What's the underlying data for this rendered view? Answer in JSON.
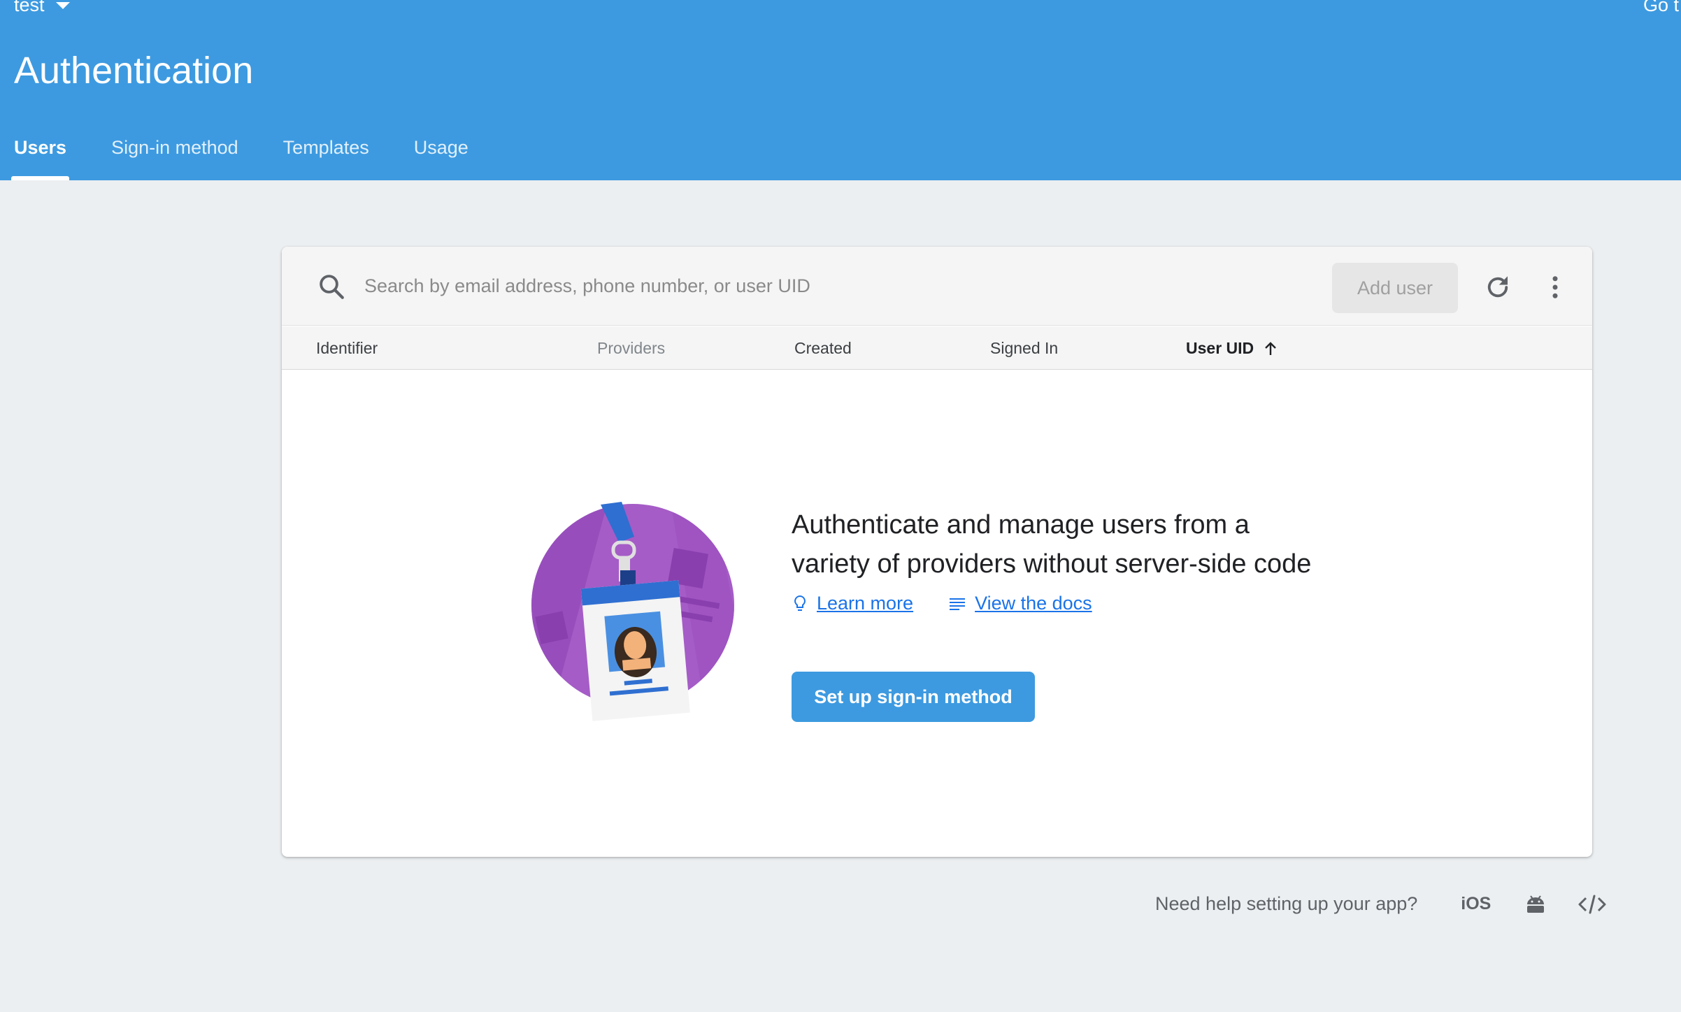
{
  "header": {
    "project_name": "test",
    "go_to_label": "Go t",
    "title": "Authentication",
    "tabs": [
      {
        "label": "Users",
        "active": true
      },
      {
        "label": "Sign-in method",
        "active": false
      },
      {
        "label": "Templates",
        "active": false
      },
      {
        "label": "Usage",
        "active": false
      }
    ],
    "color": "#3d9ae0"
  },
  "toolbar": {
    "search_placeholder": "Search by email address, phone number, or user UID",
    "add_user_label": "Add user"
  },
  "table": {
    "columns": [
      "Identifier",
      "Providers",
      "Created",
      "Signed In",
      "User UID"
    ],
    "sorted_column": "User UID",
    "sort_direction": "ascending"
  },
  "empty_state": {
    "heading_line1": "Authenticate and manage users from a",
    "heading_line2": "variety of providers without server-side code",
    "learn_more_label": "Learn more",
    "view_docs_label": "View the docs",
    "primary_button_label": "Set up sign-in method"
  },
  "footer": {
    "help_text": "Need help setting up your app?",
    "ios_label": "iOS"
  }
}
